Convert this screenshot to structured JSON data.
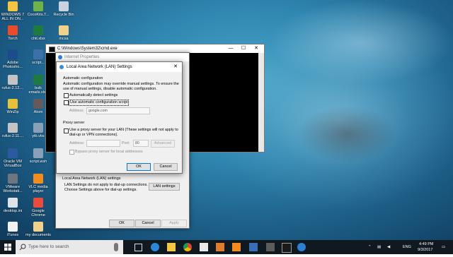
{
  "desktop": {
    "icons": [
      {
        "label": "WINDOWS 7 ALL IN ON...",
        "color": "#f4c542"
      },
      {
        "label": "CocoKits.T...",
        "color": "#6fb24a"
      },
      {
        "label": "Recycle Bin",
        "color": "#c9d3dd"
      },
      {
        "label": "Torch",
        "color": "#e94b2b"
      },
      {
        "label": "chit.xlsx",
        "color": "#1f7a3f"
      },
      {
        "label": "mcsa",
        "color": "#f1d28a"
      },
      {
        "label": "Adobe Photosho...",
        "color": "#1b4d8c"
      },
      {
        "label": "script...",
        "color": "#3d6fa8"
      },
      {
        "label": "rufus-2.12....",
        "color": "#c4c4c4"
      },
      {
        "label": "bulk emails.xlsx",
        "color": "#1f7a3f"
      },
      {
        "label": "WinZip",
        "color": "#e6c23a"
      },
      {
        "label": "Atom",
        "color": "#66595c"
      },
      {
        "label": "rufus-2.11....",
        "color": "#c4c4c4"
      },
      {
        "label": "ytb.vbs",
        "color": "#8aa0b8"
      },
      {
        "label": "Oracle VM VirtualBox",
        "color": "#2c5aa0"
      },
      {
        "label": "script.wsh",
        "color": "#8aa0b8"
      },
      {
        "label": "VMware Workstati...",
        "color": "#6e7680"
      },
      {
        "label": "VLC media player",
        "color": "#f28c1e"
      },
      {
        "label": "desktop.ini",
        "color": "#dfe3e7"
      },
      {
        "label": "Google Chrome",
        "color": "#e94b3c"
      },
      {
        "label": "iTunes",
        "color": "#f2f2f2"
      },
      {
        "label": "my documents",
        "color": "#f1d28a"
      }
    ]
  },
  "cmd": {
    "title": "C:\\Windows\\System32\\cmd.exe",
    "minimize": "—",
    "maximize": "☐",
    "close": "✕"
  },
  "internet_properties": {
    "title": "Internet Properties",
    "lan_group_title": "Local Area Network (LAN) settings",
    "lan_group_text1": "LAN Settings do not apply to dial-up connections.",
    "lan_group_text2": "Choose Settings above for dial-up settings.",
    "lan_settings_button": "LAN settings",
    "ok": "OK",
    "cancel": "Cancel",
    "apply": "Apply"
  },
  "lan_dialog": {
    "title": "Local Area Network (LAN) Settings",
    "close": "✕",
    "auto_config_heading": "Automatic configuration",
    "auto_config_desc1": "Automatic configuration may override manual settings.  To ensure the",
    "auto_config_desc2": "use of manual settings, disable automatic configuration.",
    "auto_detect_label": "Automatically detect settings",
    "auto_detect_checked": false,
    "use_script_label": "Use automatic configuration script",
    "use_script_checked": false,
    "address_label": "Address",
    "address_value": "google.com",
    "proxy_heading": "Proxy server",
    "use_proxy_label1": "Use a proxy server for your LAN (These settings will not apply to",
    "use_proxy_label2": "dial-up or VPN connections).",
    "use_proxy_checked": false,
    "proxy_address_label": "Address:",
    "proxy_address_value": "",
    "port_label": "Port:",
    "port_value": "80",
    "advanced_button": "Advanced",
    "bypass_label": "Bypass proxy server for local addresses",
    "bypass_checked": false,
    "ok": "OK",
    "cancel": "Cancel"
  },
  "taskbar": {
    "search_placeholder": "Type here to search",
    "language": "ENG",
    "time": "4:49 PM",
    "date": "9/3/2017"
  },
  "colors": {
    "accent": "#0078d7",
    "taskbar": "#101820"
  }
}
